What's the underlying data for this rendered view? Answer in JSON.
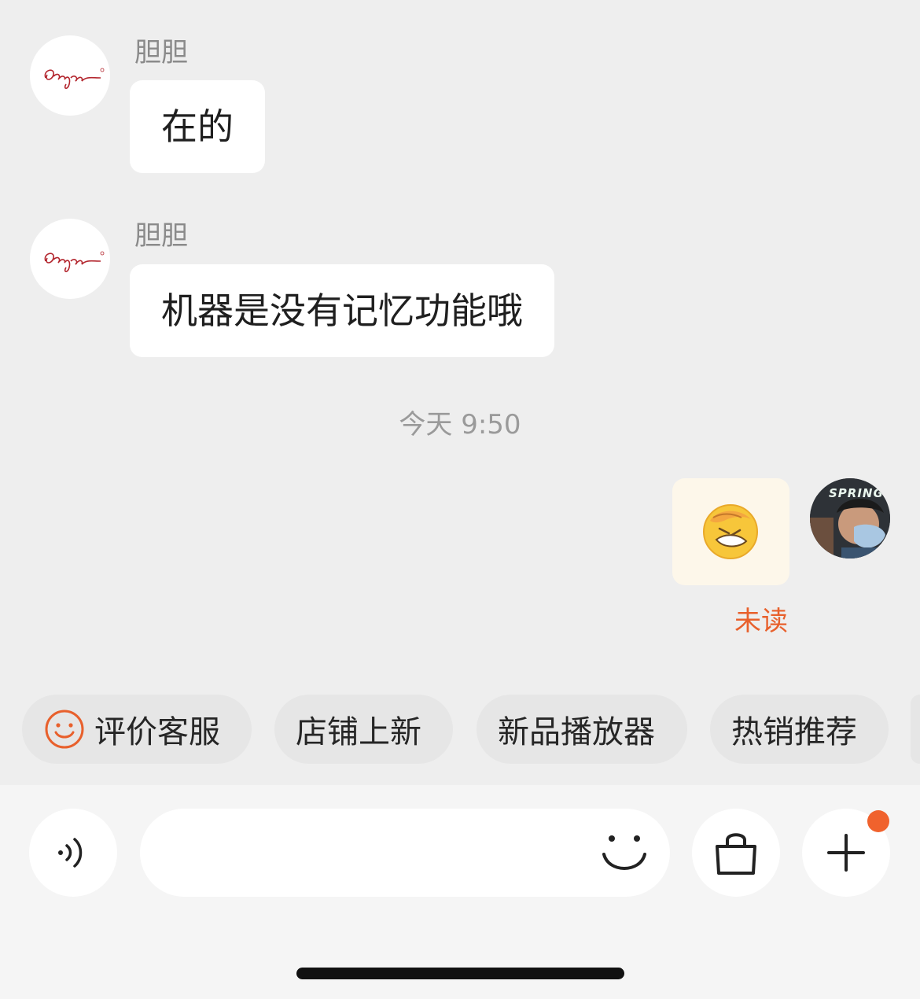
{
  "messages": [
    {
      "sender": "胆胆",
      "text": "在的"
    },
    {
      "sender": "胆胆",
      "text": "机器是没有记忆功能哦"
    }
  ],
  "timestamp": "今天 9:50",
  "my_message": {
    "type": "emoji",
    "emoji": "facepalm-emoji",
    "status": "未读"
  },
  "user_avatar_text": "SPRING",
  "quick_actions": [
    {
      "label": "评价客服",
      "icon": "smiley-icon"
    },
    {
      "label": "店铺上新"
    },
    {
      "label": "新品播放器"
    },
    {
      "label": "热销推荐"
    }
  ],
  "input_bar": {
    "voice_icon": "voice-icon",
    "emoji_icon": "smiley-icon",
    "shop_icon": "shopping-bag-icon",
    "more_icon": "plus-icon"
  },
  "colors": {
    "background": "#eeeeee",
    "accent": "#e8602c",
    "emoji_bubble": "#fdf7ea"
  }
}
